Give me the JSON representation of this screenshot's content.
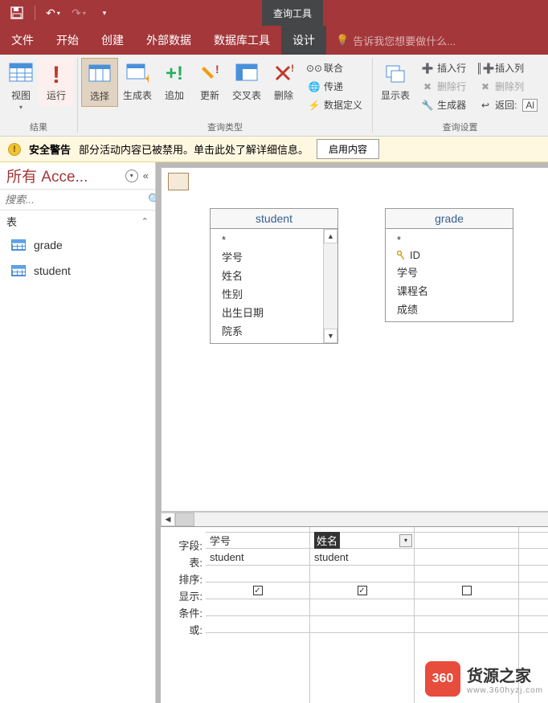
{
  "contextual_tab": "查询工具",
  "tabs": {
    "file": "文件",
    "home": "开始",
    "create": "创建",
    "external": "外部数据",
    "dbtools": "数据库工具",
    "design": "设计",
    "tellme": "告诉我您想要做什么..."
  },
  "ribbon": {
    "groups": {
      "results": "结果",
      "query_type": "查询类型",
      "query_setup": "查询设置"
    },
    "view": "视图",
    "run": "运行",
    "select": "选择",
    "maketable": "生成表",
    "append": "追加",
    "update": "更新",
    "crosstab": "交叉表",
    "delete": "删除",
    "union": "联合",
    "passthrough": "传递",
    "datadef": "数据定义",
    "showtable": "显示表",
    "insertrow": "插入行",
    "deleterow": "删除行",
    "builder": "生成器",
    "insertcol": "插入列",
    "deletecol": "删除列",
    "return": "返回:",
    "return_val": "Al"
  },
  "warning": {
    "title": "安全警告",
    "msg": "部分活动内容已被禁用。单击此处了解详细信息。",
    "btn": "启用内容"
  },
  "nav": {
    "header": "所有 Acce...",
    "search_ph": "搜索...",
    "section": "表",
    "items": [
      "grade",
      "student"
    ]
  },
  "tables": {
    "student": {
      "title": "student",
      "fields": [
        "*",
        "学号",
        "姓名",
        "性别",
        "出生日期",
        "院系"
      ]
    },
    "grade": {
      "title": "grade",
      "fields": [
        "*",
        "ID",
        "学号",
        "课程名",
        "成绩"
      ],
      "pk_index": 1
    }
  },
  "grid": {
    "labels": {
      "field": "字段:",
      "table": "表:",
      "sort": "排序:",
      "show": "显示:",
      "criteria": "条件:",
      "or": "或:"
    },
    "cols": [
      {
        "field": "学号",
        "table": "student",
        "show": true,
        "selected": false
      },
      {
        "field": "姓名",
        "table": "student",
        "show": true,
        "selected": true,
        "dropdown": true
      },
      {
        "field": "",
        "table": "",
        "show": false
      }
    ]
  },
  "watermark": {
    "badge": "360",
    "text": "货源之家",
    "url": "www.360hyzj.com"
  }
}
